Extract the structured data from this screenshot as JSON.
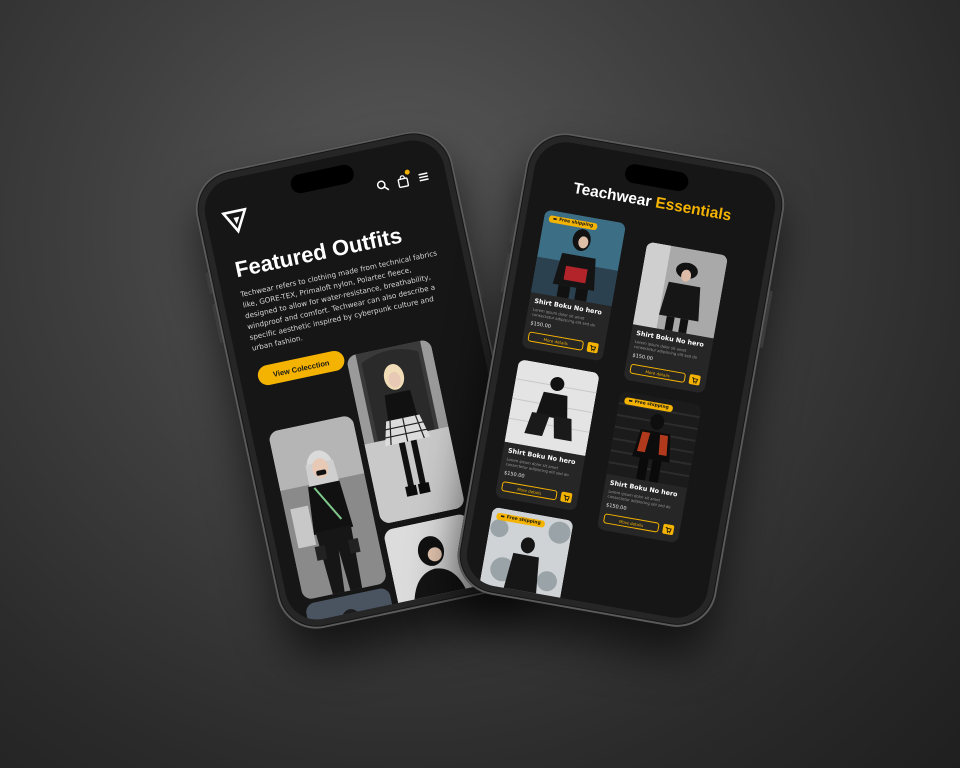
{
  "left_screen": {
    "header": {
      "logo_icon": "triangle-v-logo",
      "icons": [
        "search-icon",
        "bag-icon",
        "menu-icon"
      ]
    },
    "title": "Featured Outfits",
    "description": "Techwear refers to clothing made from technical fabrics like, GORE-TEX, Primaloft nylon, Polartec fleece, designed to allow for water-resistance, breathability, windproof and comfort. Techwear can also describe a specific aesthetic inspired by cyberpunk culture and urban fashion.",
    "cta_label": "View Colecction"
  },
  "right_screen": {
    "title_part1": "Teachwear",
    "title_part2": "Essentials",
    "badge_label": "Free shipping",
    "products": [
      {
        "name": "Shirt Boku No hero",
        "desc": "Lorem ipsum dolor sit amet consectetur adipiscing elit sed do",
        "price": "$150.00",
        "button": "More details",
        "badge": true
      },
      {
        "name": "Shirt Boku No hero",
        "desc": "Lorem ipsum dolor sit amet consectetur adipiscing elit sed do",
        "price": "$150.00",
        "button": "More details",
        "badge": false
      },
      {
        "name": "Shirt Boku No hero",
        "desc": "Lorem ipsum dolor sit amet consectetur adipiscing elit sed do",
        "price": "$150.00",
        "button": "More details",
        "badge": false
      },
      {
        "name": "Shirt Boku No hero",
        "desc": "Lorem ipsum dolor sit amet consectetur adipiscing elit sed do",
        "price": "$150.00",
        "button": "More details",
        "badge": true
      },
      {
        "name": "",
        "desc": "",
        "price": "",
        "button": "",
        "badge": true
      }
    ]
  },
  "colors": {
    "accent": "#f5b301",
    "screen_bg": "#161616",
    "card_bg": "#262626",
    "backdrop": "#3f3f3f"
  }
}
